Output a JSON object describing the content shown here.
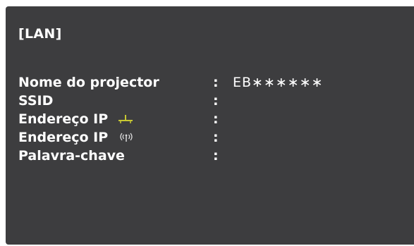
{
  "header": {
    "title": "[LAN]"
  },
  "rows": [
    {
      "label": "Nome do projector",
      "colon": ":",
      "value": "EB∗∗∗∗∗∗"
    },
    {
      "label": "SSID",
      "colon": ":",
      "value": ""
    },
    {
      "label": "Endereço IP",
      "icon": "wired-lan-icon",
      "colon": ":",
      "value": ""
    },
    {
      "label": "Endereço IP",
      "icon": "wireless-lan-icon",
      "colon": ":",
      "value": ""
    },
    {
      "label": "Palavra-chave",
      "colon": ":",
      "value": ""
    }
  ],
  "colors": {
    "background": "#3d3d3f",
    "text": "#ffffff",
    "wired_icon": "#c8c832"
  }
}
